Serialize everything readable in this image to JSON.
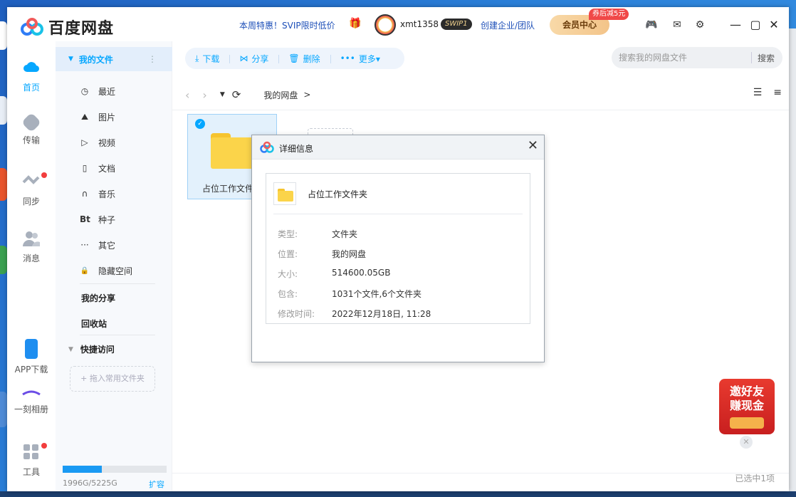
{
  "app": {
    "name": "百度网盘"
  },
  "header": {
    "promo": "本周特惠！SVIP限时低价",
    "username": "xmt1358",
    "badge": "SWIP1",
    "enterprise": "创建企业/团队",
    "vip_center": "会员中心",
    "coupon": "券后减5元"
  },
  "rail": [
    {
      "label": "首页",
      "icon": "cloud-icon"
    },
    {
      "label": "传输",
      "icon": "transfer-icon"
    },
    {
      "label": "同步",
      "icon": "sync-icon"
    },
    {
      "label": "消息",
      "icon": "people-icon"
    },
    {
      "label": "APP下载",
      "icon": "phone-icon"
    },
    {
      "label": "一刻相册",
      "icon": "album-icon"
    },
    {
      "label": "工具",
      "icon": "tools-icon"
    }
  ],
  "sidebar": {
    "my_files": "我的文件",
    "items": [
      {
        "label": "最近",
        "glyph": "◷"
      },
      {
        "label": "图片",
        "glyph": "⛰"
      },
      {
        "label": "视频",
        "glyph": "▷"
      },
      {
        "label": "文档",
        "glyph": "▯"
      },
      {
        "label": "音乐",
        "glyph": "∩"
      },
      {
        "label": "种子",
        "glyph": "Bt"
      },
      {
        "label": "其它",
        "glyph": "···"
      },
      {
        "label": "隐藏空间",
        "glyph": "🔒"
      }
    ],
    "my_share": "我的分享",
    "recycle": "回收站",
    "quick_access": "快捷访问",
    "drop_hint": "+ 拖入常用文件夹",
    "quota_text": "1996G/5225G",
    "quota_fraction": 0.38,
    "expand": "扩容"
  },
  "toolbar": {
    "download": "下载",
    "share": "分享",
    "delete": "删除",
    "more": "更多▾"
  },
  "search": {
    "placeholder": "搜索我的网盘文件",
    "button": "搜索"
  },
  "breadcrumb": {
    "root": "我的网盘",
    "sep": ">"
  },
  "file": {
    "name": "占位工作文件夹"
  },
  "status": {
    "selected": "已选中1项"
  },
  "invite": {
    "line1": "邀好友",
    "line2": "赚现金"
  },
  "dialog": {
    "title": "详细信息",
    "folder_name": "占位工作文件夹",
    "rows": [
      {
        "key": "类型:",
        "value": "文件夹"
      },
      {
        "key": "位置:",
        "value": "我的网盘"
      },
      {
        "key": "大小:",
        "value": "514600.05GB"
      },
      {
        "key": "包含:",
        "value": "1031个文件,6个文件夹"
      },
      {
        "key": "修改时间:",
        "value": "2022年12月18日, 11:28"
      }
    ]
  },
  "colors": {
    "accent": "#06a7ff",
    "folder": "#fbd44a",
    "badge_red": "#f23d3d"
  }
}
